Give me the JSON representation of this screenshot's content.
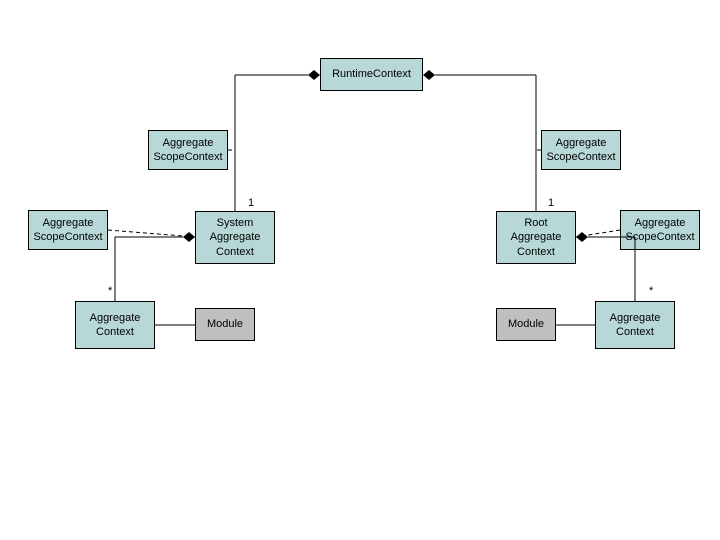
{
  "nodes": {
    "runtimeContext": "RuntimeContext",
    "aggScopeLeftTop": "Aggregate\nScopeContext",
    "aggScopeLeftMid": "Aggregate\nScopeContext",
    "systemAggCtx": "System\nAggregate\nContext",
    "aggCtxLeft": "Aggregate\nContext",
    "moduleLeft": "Module",
    "aggScopeRightTop": "Aggregate\nScopeContext",
    "rootAggCtx": "Root\nAggregate\nContext",
    "aggScopeRightMid": "Aggregate\nScopeContext",
    "moduleRight": "Module",
    "aggCtxRight": "Aggregate\nContext"
  },
  "mult": {
    "one": "1",
    "many": "*"
  }
}
